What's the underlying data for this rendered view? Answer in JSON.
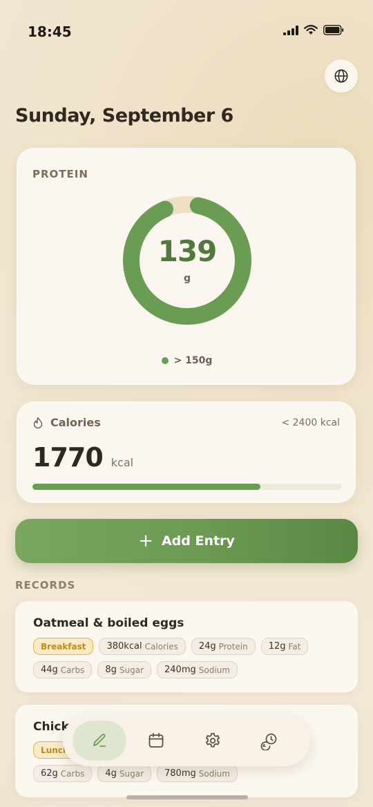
{
  "status_bar": {
    "time": "18:45"
  },
  "header": {
    "date": "Sunday, September 6"
  },
  "protein": {
    "label": "PROTEIN",
    "value": "139",
    "unit": "g",
    "goal": "> 150g",
    "progress": 0.927,
    "color": "#6a9c53",
    "track_color": "#ecdfc4"
  },
  "calories": {
    "label": "Calories",
    "goal": "< 2400 kcal",
    "value": "1770",
    "unit": "kcal",
    "progress": 0.7375
  },
  "add_entry": {
    "label": "Add Entry"
  },
  "records": {
    "label": "RECORDS",
    "items": [
      {
        "title": "Oatmeal & boiled eggs",
        "meal": "Breakfast",
        "calories_value": "380kcal",
        "calories_label": "Calories",
        "protein_value": "24g",
        "protein_label": "Protein",
        "fat_value": "12g",
        "fat_label": "Fat",
        "carbs_value": "44g",
        "carbs_label": "Carbs",
        "sugar_value": "8g",
        "sugar_label": "Sugar",
        "sodium_value": "240mg",
        "sodium_label": "Sodium"
      },
      {
        "title": "Chick",
        "meal": "Lunch",
        "carbs_value": "62g",
        "carbs_label": "Carbs",
        "sugar_value": "4g",
        "sugar_label": "Sugar",
        "sodium_value": "780mg",
        "sodium_label": "Sodium"
      }
    ]
  },
  "nav": {
    "items": [
      {
        "icon": "pencil-icon",
        "active": true
      },
      {
        "icon": "calendar-icon",
        "active": false
      },
      {
        "icon": "gear-icon",
        "active": false
      },
      {
        "icon": "history-icon",
        "active": false
      }
    ]
  }
}
